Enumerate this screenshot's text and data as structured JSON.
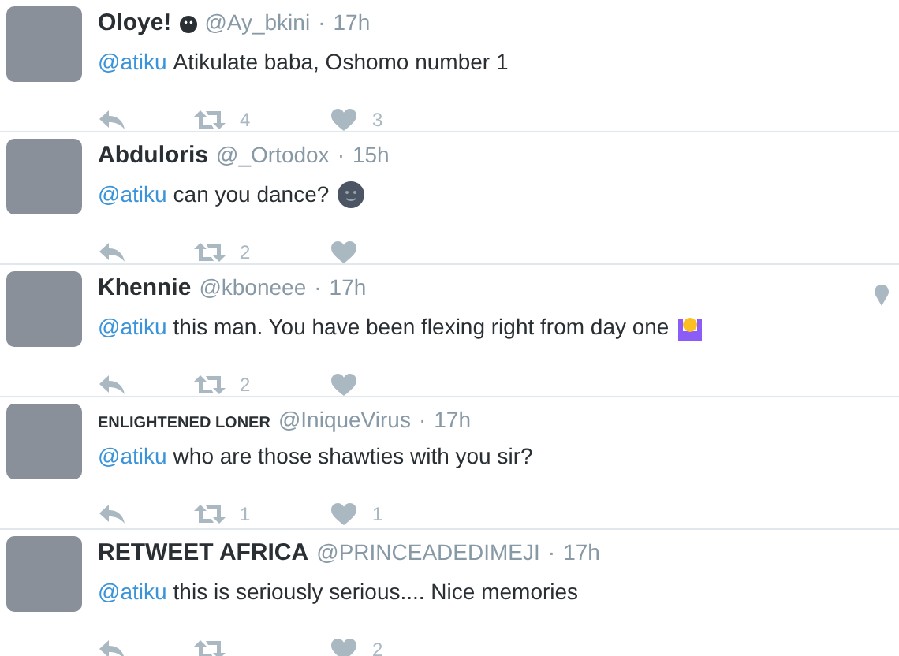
{
  "tweets": [
    {
      "name": "Oloye!",
      "small_name": false,
      "badge": true,
      "handle": "@Ay_bkini",
      "separator": "·",
      "time": "17h",
      "mention": "@atiku",
      "text": "Atikulate baba, Oshomo number 1",
      "moon_emoji": false,
      "person_emoji": false,
      "location": false,
      "retweets": "4",
      "likes": "3"
    },
    {
      "name": "Abduloris",
      "small_name": false,
      "badge": false,
      "handle": "@_Ortodox",
      "separator": "·",
      "time": "15h",
      "mention": "@atiku",
      "text": "can you dance?",
      "moon_emoji": true,
      "person_emoji": false,
      "location": false,
      "retweets": "2"
    },
    {
      "name": "Khennie",
      "small_name": false,
      "badge": false,
      "handle": "@kboneee",
      "separator": "·",
      "time": "17h",
      "mention": "@atiku",
      "text": "this man. You have been flexing right from day one",
      "moon_emoji": false,
      "person_emoji": true,
      "location": true,
      "retweets": "2"
    },
    {
      "name": "ENLIGHTENED LONER",
      "small_name": true,
      "badge": false,
      "handle": "@IniqueVirus",
      "separator": "·",
      "time": "17h",
      "mention": "@atiku",
      "text": "who are those shawties with you sir?",
      "moon_emoji": false,
      "person_emoji": false,
      "location": false,
      "retweets": "1",
      "likes": "1"
    },
    {
      "name": "RETWEET AFRICA",
      "small_name": false,
      "badge": false,
      "handle": "@PRINCEADEDIMEJI",
      "separator": "·",
      "time": "17h",
      "mention": "@atiku",
      "text": "this is seriously serious.... Nice memories",
      "moon_emoji": false,
      "person_emoji": false,
      "location": false,
      "likes": "2"
    }
  ]
}
